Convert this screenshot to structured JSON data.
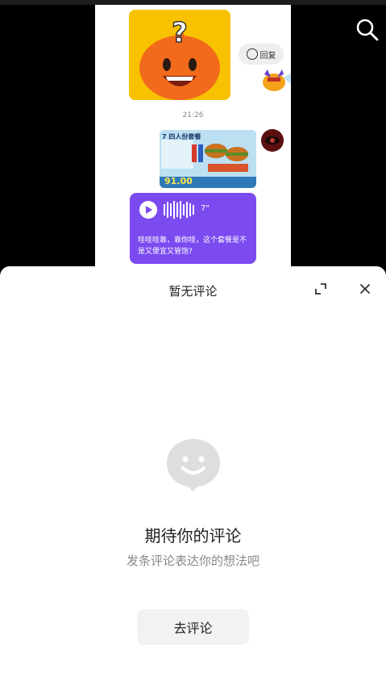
{
  "chat": {
    "reply_chip_label": "回复",
    "timestamp": "21:26",
    "menu_image": {
      "title": "7 四人份套餐",
      "price": "91.00"
    },
    "voice_message": {
      "duration": "7\"",
      "transcript": "哇哇哇靠，靠你哇，这个套餐是不是又便宜又管饱?"
    }
  },
  "sheet": {
    "title": "暂无评论",
    "empty_title": "期待你的评论",
    "empty_subtitle": "发条评论表达你的想法吧",
    "comment_button_label": "去评论"
  },
  "colors": {
    "voice_card": "#7b4bf0",
    "sticker_bg": "#f9c200",
    "sheet_bg": "#ffffff",
    "button_bg": "#f2f2f2"
  },
  "icons": [
    "search-icon",
    "smile-icon",
    "expand-icon",
    "close-icon",
    "play-icon",
    "empty-comment-icon"
  ]
}
